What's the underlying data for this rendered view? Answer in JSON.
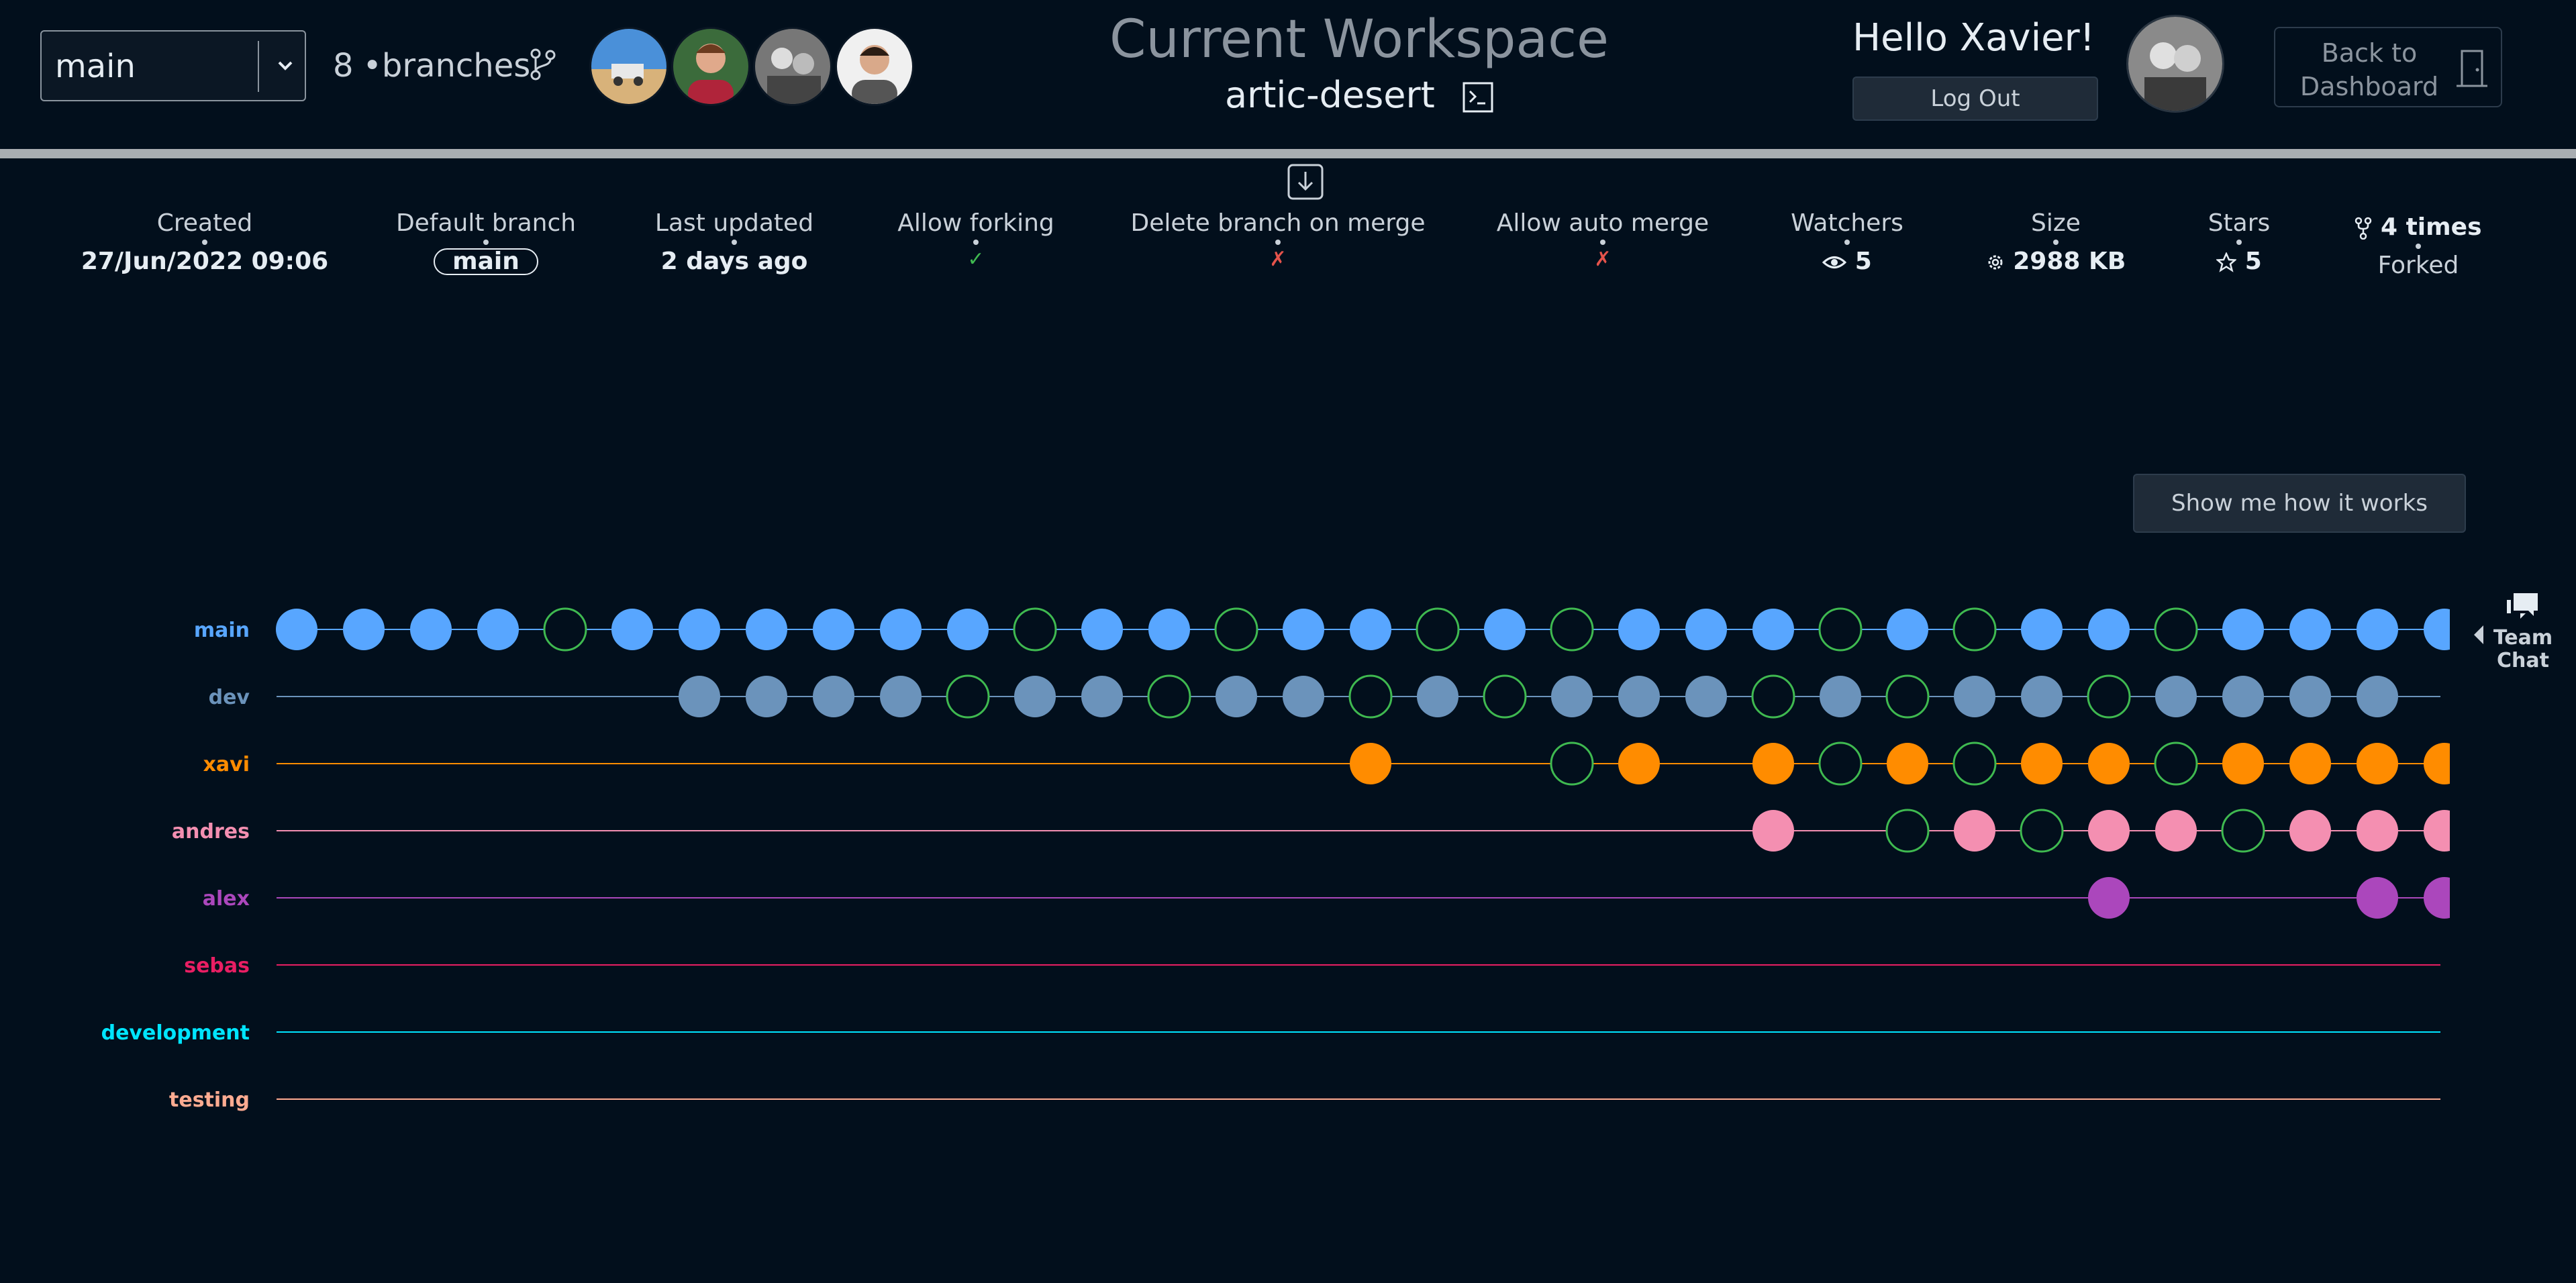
{
  "header": {
    "branch_select": {
      "value": "main"
    },
    "branch_count": "8",
    "branch_label": "•branches",
    "workspace_title": "Current Workspace",
    "workspace_name": "artic-desert",
    "greeting": "Hello Xavier!",
    "logout_label": "Log Out",
    "back_label_line1": "Back to",
    "back_label_line2": "Dashboard"
  },
  "stats": {
    "created": {
      "label": "Created",
      "value": "27/Jun/2022 09:06"
    },
    "default_branch": {
      "label": "Default branch",
      "value": "main"
    },
    "last_updated": {
      "label": "Last updated",
      "value": "2 days ago"
    },
    "allow_forking": {
      "label": "Allow forking",
      "value": "✓"
    },
    "delete_branch": {
      "label": "Delete branch on merge",
      "value": "✗"
    },
    "auto_merge": {
      "label": "Allow auto merge",
      "value": "✗"
    },
    "watchers": {
      "label": "Watchers",
      "value": "5"
    },
    "size": {
      "label": "Size",
      "value": "2988 KB"
    },
    "stars": {
      "label": "Stars",
      "value": "5"
    },
    "forked": {
      "value": "4 times",
      "label": "Forked"
    }
  },
  "help_button_label": "Show me how it works",
  "team_chat": {
    "line1": "Team",
    "line2": "Chat"
  },
  "icons": {
    "branch": "git-branch-icon",
    "terminal": "terminal-icon",
    "door": "door-exit-icon",
    "download": "download-icon",
    "eye": "eye-icon",
    "size": "gear-icon",
    "star": "star-icon",
    "fork": "fork-icon",
    "chat": "chat-icon"
  },
  "colors": {
    "background": "#020f1c",
    "merge_ring": "#3fb950",
    "check": "#3fb950",
    "cross": "#e5534b"
  },
  "graph": {
    "column_count": 33,
    "branches": [
      {
        "name": "main",
        "color": "#58a6ff",
        "label_color": "#58a6ff",
        "line_color": "#58a6ff",
        "commits": "CCCCMCCCCCCMCCMCCMCMCCCMCMCCMCCCC"
      },
      {
        "name": "dev",
        "color": "#6b93bb",
        "label_color": "#6b93bb",
        "line_color": "#6b93bb",
        "commits": "......CCCCMCCMCCMCMCCCMCMCCMCCCC"
      },
      {
        "name": "xavi",
        "color": "#ff8c00",
        "label_color": "#ff8c00",
        "line_color": "#ff8c00",
        "commits": "................C..MC.CMCMCCMCCCC"
      },
      {
        "name": "andres",
        "color": "#f48fb1",
        "label_color": "#f48fb1",
        "line_color": "#f48fb1",
        "commits": "......................C.MCMCCMCCCC"
      },
      {
        "name": "alex",
        "color": "#ab47bc",
        "label_color": "#ab47bc",
        "line_color": "#ab47bc",
        "commits": "...........................C...CCC"
      },
      {
        "name": "sebas",
        "color": "#e91e63",
        "label_color": "#e91e63",
        "line_color": "#e91e63",
        "commits": ""
      },
      {
        "name": "development",
        "color": "#00e5ff",
        "label_color": "#00e5ff",
        "line_color": "#00e5ff",
        "commits": ""
      },
      {
        "name": "testing",
        "color": "#ffab91",
        "label_color": "#ffab91",
        "line_color": "#ffab91",
        "commits": ""
      }
    ]
  }
}
